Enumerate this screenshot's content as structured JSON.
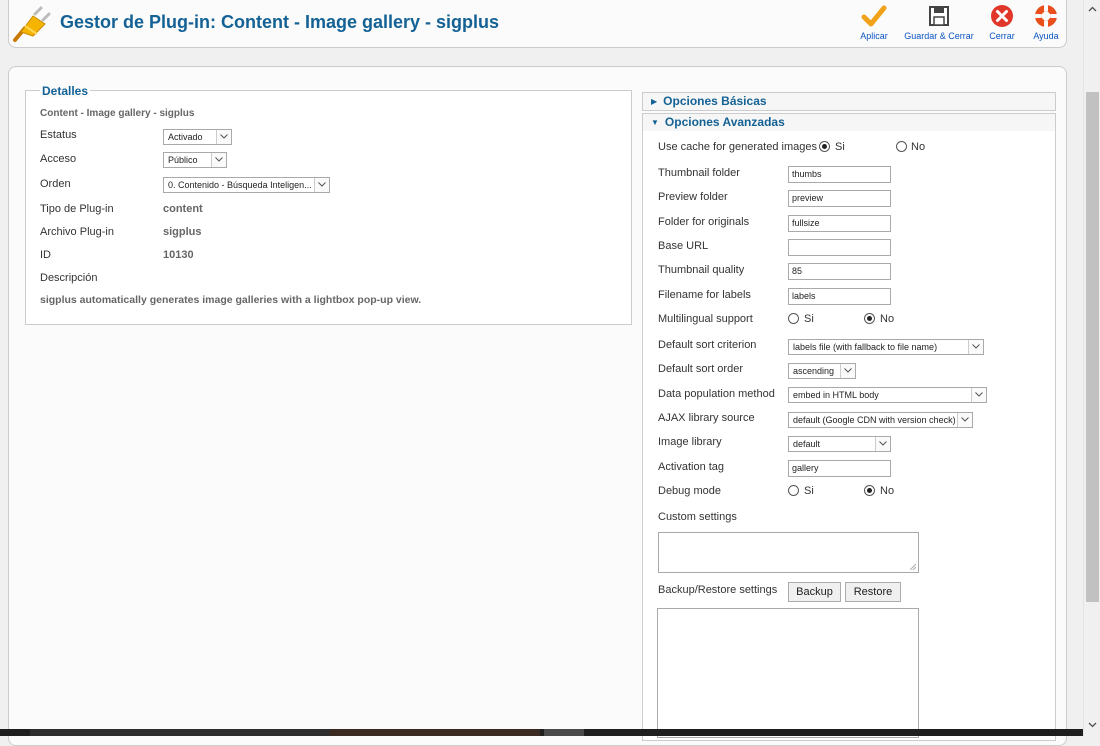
{
  "header": {
    "title": "Gestor de Plug-in: Content - Image gallery - sigplus",
    "icon": "plugin-icon",
    "buttons": [
      {
        "label": "Aplicar",
        "icon": "checkmark-icon",
        "color": "#f0a31a"
      },
      {
        "label": "Guardar & Cerrar",
        "icon": "save-icon",
        "color": "#444444"
      },
      {
        "label": "Cerrar",
        "icon": "close-icon",
        "color": "#e0372a"
      },
      {
        "label": "Ayuda",
        "icon": "help-icon",
        "color": "#e94e1b"
      }
    ]
  },
  "details": {
    "legend": "Detalles",
    "subtitle": "Content - Image gallery - sigplus",
    "status_label": "Estatus",
    "status_value": "Activado",
    "access_label": "Acceso",
    "access_value": "Público",
    "order_label": "Orden",
    "order_value": "0. Contenido - Búsqueda Inteligen...",
    "type_label": "Tipo de Plug-in",
    "type_value": "content",
    "file_label": "Archivo Plug-in",
    "file_value": "sigplus",
    "id_label": "ID",
    "id_value": "10130",
    "desc_label": "Descripción",
    "desc_value": "sigplus automatically generates image galleries with a lightbox pop-up view."
  },
  "panes": {
    "basic": "Opciones Básicas",
    "advanced": "Opciones Avanzadas"
  },
  "options": {
    "cache_label": "Use cache for generated images",
    "yes": "Si",
    "no": "No",
    "thumb_folder_label": "Thumbnail folder",
    "thumb_folder_value": "thumbs",
    "preview_folder_label": "Preview folder",
    "preview_folder_value": "preview",
    "originals_label": "Folder for originals",
    "originals_value": "fullsize",
    "base_url_label": "Base URL",
    "base_url_value": "",
    "quality_label": "Thumbnail quality",
    "quality_value": "85",
    "labels_file_label": "Filename for labels",
    "labels_file_value": "labels",
    "multilingual_label": "Multilingual support",
    "sort_criterion_label": "Default sort criterion",
    "sort_criterion_value": "labels file (with fallback to file name)",
    "sort_order_label": "Default sort order",
    "sort_order_value": "ascending",
    "population_label": "Data population method",
    "population_value": "embed in HTML body",
    "ajax_label": "AJAX library source",
    "ajax_value": "default (Google CDN with version check)",
    "image_lib_label": "Image library",
    "image_lib_value": "default",
    "activation_tag_label": "Activation tag",
    "activation_tag_value": "gallery",
    "debug_label": "Debug mode",
    "custom_settings_label": "Custom settings",
    "backup_label": "Backup/Restore settings",
    "backup_button": "Backup",
    "restore_button": "Restore"
  }
}
